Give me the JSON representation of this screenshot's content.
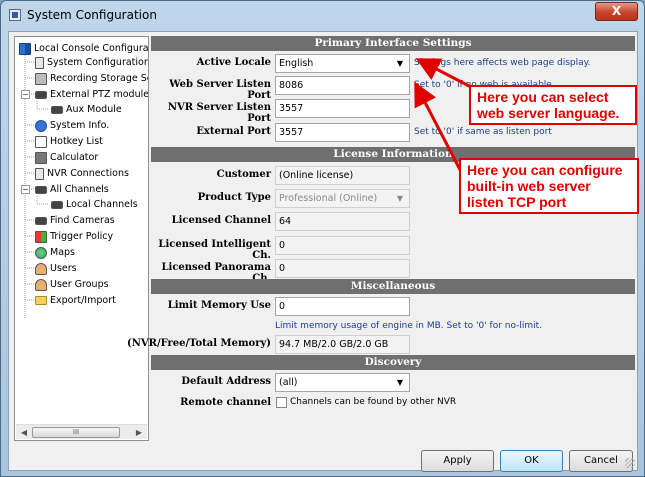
{
  "window": {
    "title": "System Configuration",
    "close_glyph": "X"
  },
  "tree": {
    "items": [
      {
        "label": "Local Console Configurati",
        "icon": "grid-icon"
      },
      {
        "label": "System Configuration",
        "icon": "device-icon"
      },
      {
        "label": "Recording Storage Se",
        "icon": "disk-icon"
      },
      {
        "label": "External PTZ module",
        "icon": "camera-icon"
      },
      {
        "label": "Aux Module",
        "icon": "camera-icon"
      },
      {
        "label": "System Info.",
        "icon": "info-icon"
      },
      {
        "label": "Hotkey List",
        "icon": "list-icon"
      },
      {
        "label": "Calculator",
        "icon": "calculator-icon"
      },
      {
        "label": "NVR Connections",
        "icon": "device-icon"
      },
      {
        "label": "All Channels",
        "icon": "camera-icon"
      },
      {
        "label": "Local Channels",
        "icon": "camera-icon"
      },
      {
        "label": "Find Cameras",
        "icon": "camera-icon"
      },
      {
        "label": "Trigger Policy",
        "icon": "trigger-icon"
      },
      {
        "label": "Maps",
        "icon": "globe-icon"
      },
      {
        "label": "Users",
        "icon": "user-icon"
      },
      {
        "label": "User Groups",
        "icon": "users-icon"
      },
      {
        "label": "Export/Import",
        "icon": "folder-icon"
      }
    ],
    "scroll_thumb": "III"
  },
  "primary": {
    "header": "Primary Interface Settings",
    "locale_label": "Active Locale",
    "locale_value": "English",
    "locale_hint": "Settings here affects web page display.",
    "web_label": "Web Server Listen Port",
    "web_value": "8086",
    "web_hint": "Set to '0' if no web is available",
    "nvr_label": "NVR Server Listen Port",
    "nvr_value": "3557",
    "ext_label": "External Port",
    "ext_value": "3557",
    "ext_hint": "Set to '0' if same as listen port"
  },
  "license": {
    "header": "License Information",
    "customer_label": "Customer",
    "customer_value": "(Online license)",
    "product_label": "Product Type",
    "product_value": "Professional (Online)",
    "channel_label": "Licensed Channel",
    "channel_value": "64",
    "intel_label": "Licensed Intelligent Ch.",
    "intel_value": "0",
    "pano_label": "Licensed Panorama Ch.",
    "pano_value": "0"
  },
  "misc": {
    "header": "Miscellaneous",
    "mem_label": "Limit Memory Use",
    "mem_value": "0",
    "mem_hint": "Limit memory usage of engine in MB. Set to '0' for no-limit.",
    "total_label": "(NVR/Free/Total Memory)",
    "total_value": "94.7 MB/2.0 GB/2.0 GB"
  },
  "discovery": {
    "header": "Discovery",
    "addr_label": "Default Address",
    "addr_value": "(all)",
    "remote_label": "Remote channel",
    "remote_hint": "Channels can be found by other NVR"
  },
  "buttons": {
    "apply": "Apply",
    "ok": "OK",
    "cancel": "Cancel"
  },
  "callouts": {
    "language": "Here you can select web server language.",
    "port": "Here you can configure built-in web server listen TCP port"
  },
  "colors": {
    "callout": "#e00000",
    "header": "#6f6f6f",
    "hint": "#1a3f8a"
  }
}
